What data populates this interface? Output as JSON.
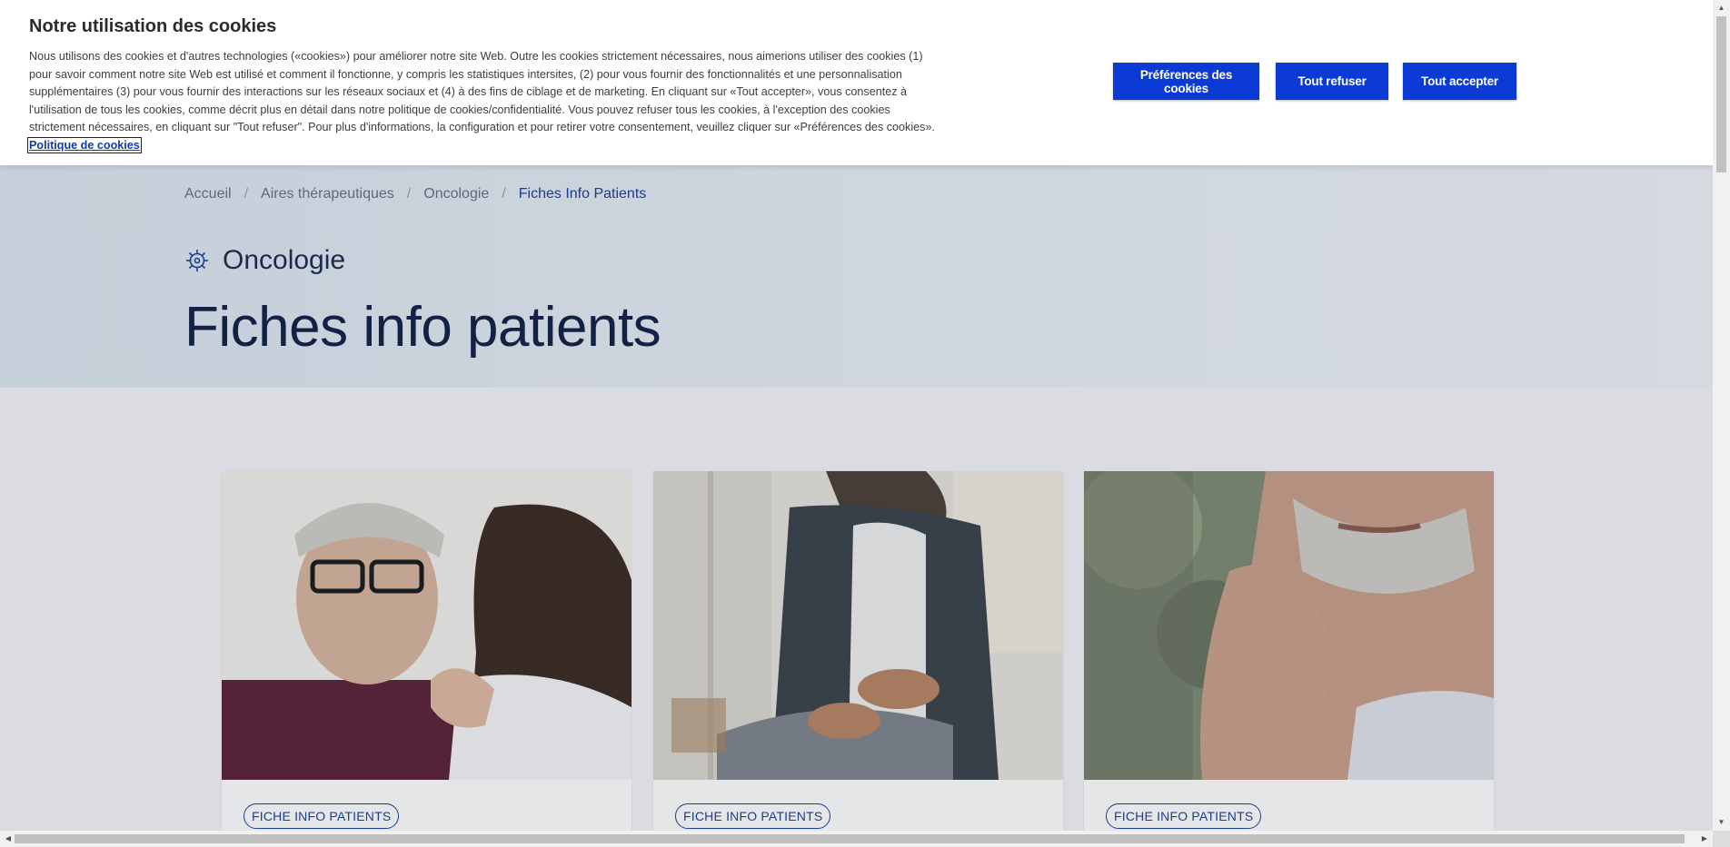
{
  "cookie_banner": {
    "title": "Notre utilisation des cookies",
    "text": "Nous utilisons des cookies et d'autres technologies («cookies») pour améliorer notre site Web. Outre les cookies strictement nécessaires, nous aimerions utiliser des cookies (1) pour savoir comment notre site Web est utilisé et comment il fonctionne, y compris les statistiques intersites, (2) pour vous fournir des fonctionnalités et une personnalisation supplémentaires (3) pour vous fournir des interactions sur les réseaux sociaux et (4) à des fins de ciblage et de marketing. En cliquant sur «Tout accepter», vous consentez à l'utilisation de tous les cookies, comme décrit plus en détail dans notre politique de cookies/confidentialité. Vous pouvez refuser tous les cookies, à l'exception des cookies strictement nécessaires, en cliquant sur \"Tout refuser\". Pour plus d'informations, la configuration et pour retirer votre consentement, veuillez cliquer sur «Préférences des cookies».",
    "policy_link": "Politique de cookies",
    "buttons": {
      "preferences": "Préférences des cookies",
      "reject_all": "Tout refuser",
      "accept_all": "Tout accepter"
    },
    "button_color": "#0b3bd4"
  },
  "breadcrumb": {
    "items": [
      "Accueil",
      "Aires thérapeutiques",
      "Oncologie"
    ],
    "current": "Fiches Info Patients",
    "separator": "/"
  },
  "therapeutic_area": {
    "icon": "cell-icon",
    "label": "Oncologie"
  },
  "page_title": "Fiches info patients",
  "cards": [
    {
      "badge": "FICHE INFO PATIENTS",
      "image": "doctor-examining-patient-neck-photo"
    },
    {
      "badge": "FICHE INFO PATIENTS",
      "image": "man-holding-stomach-photo"
    },
    {
      "badge": "FICHE INFO PATIENTS",
      "image": "man-touching-jaw-photo"
    }
  ],
  "colors": {
    "accent": "#1a3f9b",
    "title": "#0f1f45"
  }
}
